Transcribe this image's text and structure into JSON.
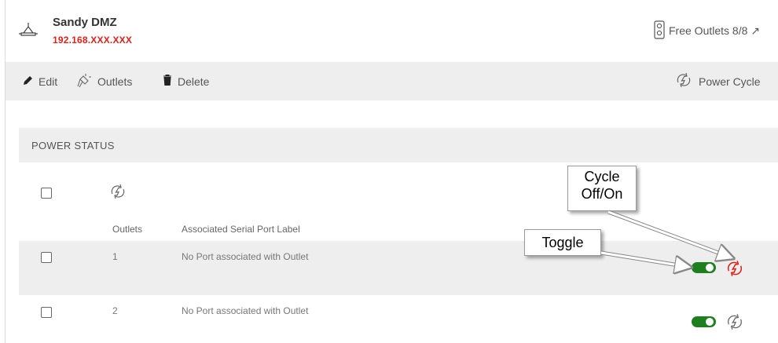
{
  "device": {
    "name": "Sandy DMZ",
    "ip": "192.168.XXX.XXX",
    "free_outlets": "Free Outlets 8/8 ↗"
  },
  "toolbar": {
    "edit_label": "Edit",
    "outlets_label": "Outlets",
    "delete_label": "Delete",
    "power_cycle_label": "Power Cycle"
  },
  "power_status": {
    "title": "POWER STATUS",
    "columns": {
      "outlets": "Outlets",
      "label": "Associated Serial Port Label"
    },
    "rows": [
      {
        "outlet": "1",
        "label": "No Port associated with Outlet",
        "toggle_on": true,
        "cycle_highlight": true
      },
      {
        "outlet": "2",
        "label": "No Port associated with Outlet",
        "toggle_on": true,
        "cycle_highlight": false
      }
    ]
  },
  "annotations": {
    "cycle": "Cycle\nOff/On",
    "toggle": "Toggle"
  },
  "colors": {
    "accent_red": "#e0201b",
    "toggle_green": "#1e7f1f",
    "panel_gray": "#eeeeee"
  }
}
